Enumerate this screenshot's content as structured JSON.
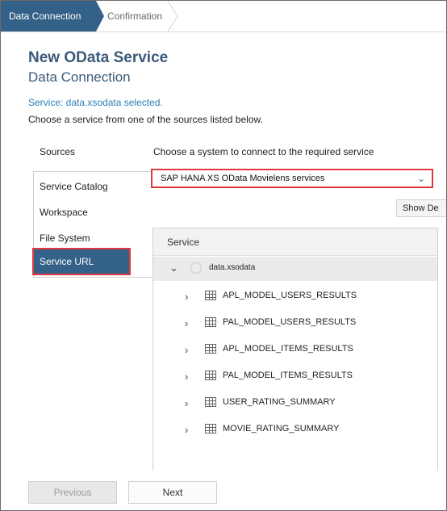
{
  "wizard": {
    "steps": [
      {
        "label": "Data Connection",
        "active": true
      },
      {
        "label": "Confirmation",
        "active": false
      }
    ]
  },
  "header": {
    "title": "New OData Service",
    "subtitle": "Data Connection"
  },
  "status_text": "Service: data.xsodata selected.",
  "instruction": "Choose a service from one of the sources listed below.",
  "sources": {
    "heading": "Sources",
    "items": [
      "Service Catalog",
      "Workspace",
      "File System",
      "Service URL"
    ],
    "selected": "Service URL"
  },
  "system": {
    "heading": "Choose a system to connect to the required service",
    "selected_value": "SAP HANA XS OData Movielens services"
  },
  "show_button_label": "Show De",
  "tree": {
    "column_header": "Service",
    "root": "data.xsodata",
    "items": [
      "APL_MODEL_USERS_RESULTS",
      "PAL_MODEL_USERS_RESULTS",
      "APL_MODEL_ITEMS_RESULTS",
      "PAL_MODEL_ITEMS_RESULTS",
      "USER_RATING_SUMMARY",
      "MOVIE_RATING_SUMMARY"
    ]
  },
  "footer": {
    "previous_label": "Previous",
    "next_label": "Next"
  },
  "colors": {
    "accent": "#346187",
    "highlight": "#e0393e",
    "link": "#2c7fb8"
  }
}
